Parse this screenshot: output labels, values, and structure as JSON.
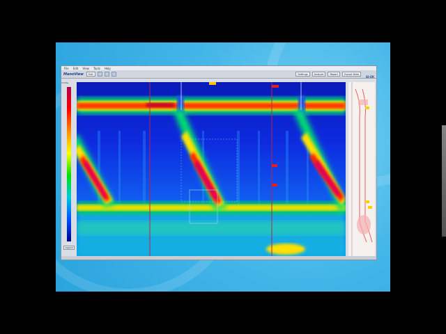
{
  "app": {
    "logo": "ManoView",
    "brand": "GI-EK",
    "menu": [
      "File",
      "Edit",
      "View",
      "Tools",
      "Help"
    ],
    "toolbar_left": [
      "Exit",
      "",
      "",
      ""
    ],
    "toolbar_right": [
      "Settings",
      "Analyze",
      "Report",
      "Export Data"
    ],
    "colorbar_label": "mmHg",
    "legend_button": "Legend"
  },
  "colors": {
    "slide": "#2aa3dd",
    "plot_base": "#0b1fd0",
    "app_bg": "#d9dde4"
  },
  "icons": [
    "manoview-logo-icon",
    "toolbar-icon",
    "colorbar"
  ]
}
